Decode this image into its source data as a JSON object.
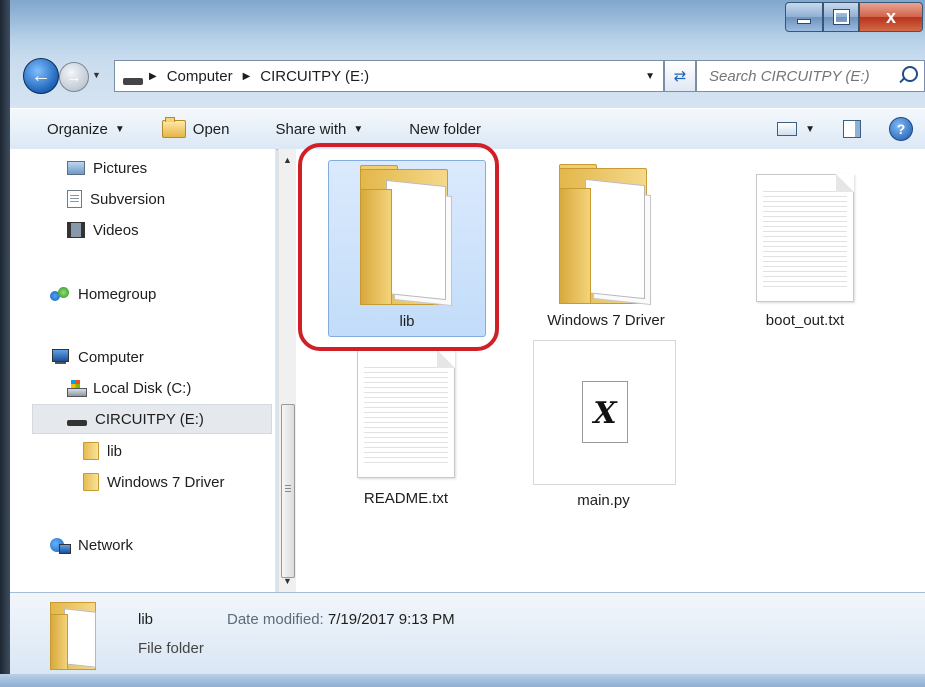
{
  "window": {
    "caption_buttons": {
      "minimize": "",
      "maximize": "",
      "close": "x"
    }
  },
  "nav": {
    "address": [
      "Computer",
      "CIRCUITPY (E:)"
    ],
    "search_placeholder": "Search CIRCUITPY (E:)"
  },
  "toolbar": {
    "organize": "Organize",
    "open": "Open",
    "share_with": "Share with",
    "new_folder": "New folder"
  },
  "sidebar": {
    "items": [
      {
        "label": "Pictures",
        "icon": "pictures-icon"
      },
      {
        "label": "Subversion",
        "icon": "document-icon"
      },
      {
        "label": "Videos",
        "icon": "videos-icon"
      },
      {
        "label": "Homegroup",
        "icon": "homegroup-icon"
      },
      {
        "label": "Computer",
        "icon": "computer-icon"
      },
      {
        "label": "Local Disk (C:)",
        "icon": "local-disk-icon"
      },
      {
        "label": "CIRCUITPY (E:)",
        "icon": "usb-drive-icon",
        "selected": true
      },
      {
        "label": "lib",
        "icon": "folder-icon"
      },
      {
        "label": "Windows 7 Driver",
        "icon": "folder-icon"
      },
      {
        "label": "Network",
        "icon": "network-icon"
      }
    ]
  },
  "files": [
    {
      "name": "lib",
      "kind": "folder",
      "selected": true
    },
    {
      "name": "Windows 7 Driver",
      "kind": "folder"
    },
    {
      "name": "boot_out.txt",
      "kind": "text"
    },
    {
      "name": "README.txt",
      "kind": "text"
    },
    {
      "name": "main.py",
      "kind": "python"
    }
  ],
  "details": {
    "name": "lib",
    "type": "File folder",
    "modified_label": "Date modified:",
    "modified_value": "7/19/2017 9:13 PM"
  },
  "colors": {
    "highlight_ring": "#d11f28",
    "selection": "#c2dcfa"
  }
}
